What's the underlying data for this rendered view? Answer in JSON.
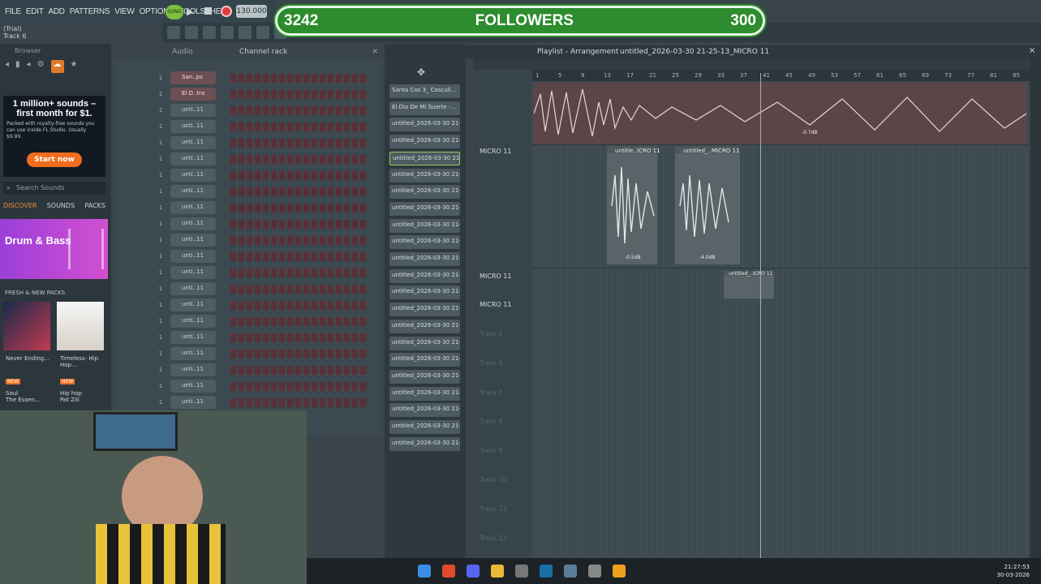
{
  "menu": [
    "FILE",
    "EDIT",
    "ADD",
    "PATTERNS",
    "VIEW",
    "OPTIONS",
    "TOOLS",
    "HELP"
  ],
  "info": {
    "line1": "(Trial)",
    "line2": "Track 6"
  },
  "transport": {
    "tempo": "130.000",
    "song_mode": "SONG"
  },
  "overlay": {
    "left_count": "3242",
    "title": "FOLLOWERS",
    "right_count": "300"
  },
  "browser": {
    "title": "Browser",
    "ad_title": "1 million+ sounds – first month for $1.",
    "ad_sub": "Packed with royalty-free sounds you can use inside FL Studio. Usually $9.99.",
    "ad_button": "Start now",
    "search_placeholder": "Search Sounds",
    "tabs": [
      "DISCOVER",
      "SOUNDS",
      "PACKS"
    ],
    "promo": "Drum & Bass",
    "section": "FRESH & NEW PACKS",
    "packs": [
      {
        "title": "Never Ending...",
        "tag": "NEW",
        "genre": "Soul",
        "author": "The Essen..."
      },
      {
        "title": "Timeless- Hip Hop...",
        "tag": "NEW",
        "genre": "Hip hop",
        "author": "Pat Zili"
      }
    ]
  },
  "channel_rack": {
    "title": "Channel rack",
    "group": "Audio",
    "channels": [
      "San..ps",
      "El D..tra",
      "unti..11",
      "unti..11",
      "unti..11",
      "unti..11",
      "unti..11",
      "unti..11",
      "unti..11",
      "unti..11",
      "unti..11",
      "unti..11",
      "unti..11",
      "unti..11",
      "unti..11",
      "unti..11",
      "unti..11",
      "unti..11",
      "unti..11",
      "unti..11",
      "unti..11"
    ],
    "number": "1"
  },
  "patterns": [
    "Santa Cos 3_ Cosculi...",
    "El Dia De Mi Suerte -...",
    "untitled_2026-03-30 21-...",
    "untitled_2026-03-30 21-...",
    "untitled_2026-03-30 21-...",
    "untitled_2026-03-30 21-...",
    "untitled_2026-03-30 21-...",
    "untitled_2026-03-30 21-...",
    "untitled_2026-03-30 21-...",
    "untitled_2026-03-30 21-...",
    "untitled_2026-03-30 21-...",
    "untitled_2026-03-30 21-...",
    "untitled_2026-03-30 21-...",
    "untitled_2026-03-30 21-...",
    "untitled_2026-03-30 21-...",
    "untitled_2026-03-30 21-...",
    "untitled_2026-03-30 21-...",
    "untitled_2026-03-30 21-...",
    "untitled_2026-03-30 21-...",
    "untitled_2026-03-30 21-...",
    "untitled_2026-03-30 21-...",
    "untitled_2026-03-30 21-..."
  ],
  "playlist": {
    "title": "Playlist - Arrangement",
    "breadcrumb": "untitled_2026-03-30 21-25-13_MICRO 11",
    "bars": [
      "1",
      "5",
      "9",
      "13",
      "17",
      "21",
      "25",
      "29",
      "33",
      "37",
      "41",
      "45",
      "49",
      "53",
      "57",
      "61",
      "65",
      "69",
      "73",
      "77",
      "81",
      "85"
    ],
    "tracks": [
      "MICRO 11",
      "MICRO 11",
      "MICRO 11",
      "Track 5",
      "Track 6",
      "Track 7",
      "Track 8",
      "Track 9",
      "Track 10",
      "Track 11",
      "Track 12"
    ],
    "clip1_db": "-0.7dB",
    "clips": [
      {
        "name": "untitle..ICRO 11",
        "db": "-0.5dB"
      },
      {
        "name": "untitled_..MICRO 11",
        "db": "-4.0dB"
      },
      {
        "name": "untitled_..ICRO 11",
        "db": ""
      }
    ]
  },
  "taskbar": {
    "time": "21:27:53",
    "date": "30-03-2026"
  }
}
